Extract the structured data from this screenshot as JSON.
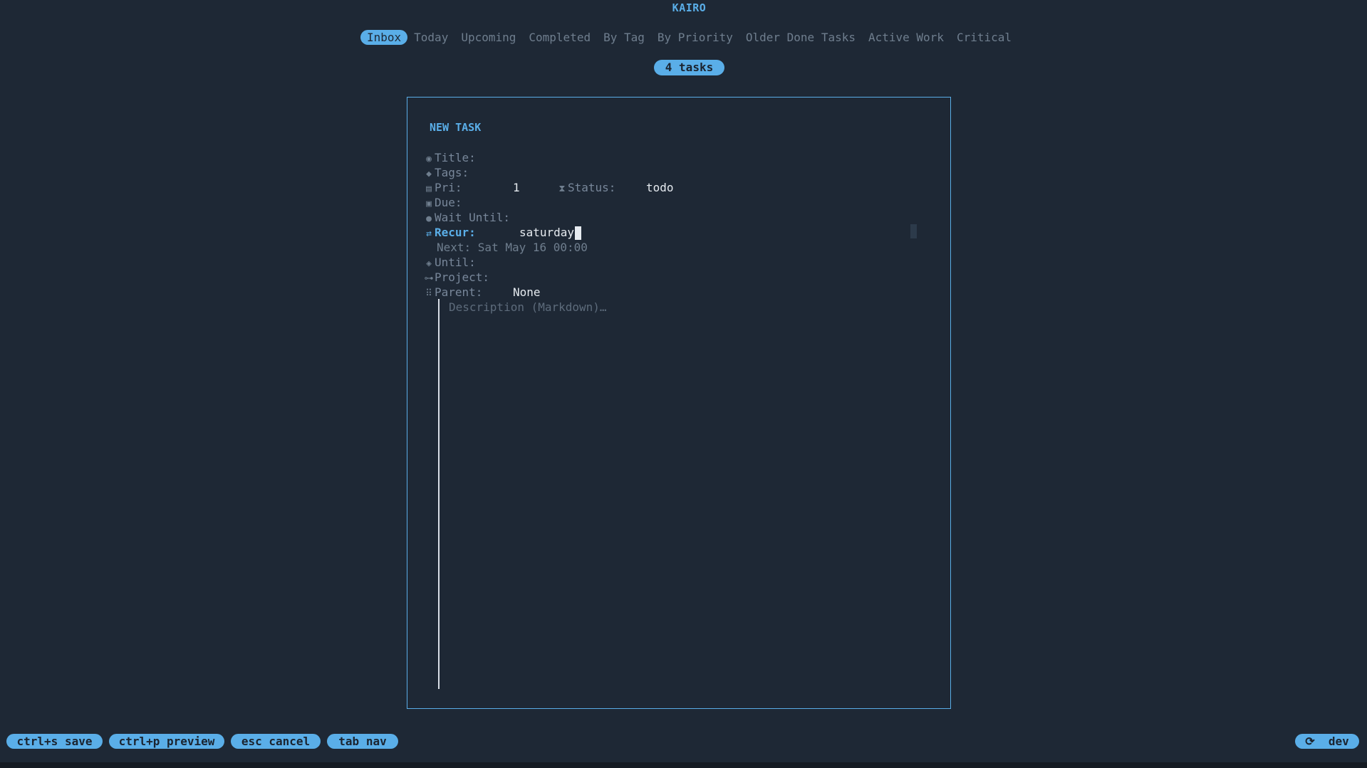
{
  "app": {
    "title": "KAIRO"
  },
  "tabs": [
    "Inbox",
    "Today",
    "Upcoming",
    "Completed",
    "By Tag",
    "By Priority",
    "Older Done Tasks",
    "Active Work",
    "Critical"
  ],
  "active_tab": "Inbox",
  "task_count": "4 tasks",
  "form": {
    "title": "NEW TASK",
    "fields": {
      "title": {
        "label": "Title:",
        "value": "",
        "icon": "eye-icon"
      },
      "tags": {
        "label": "Tags:",
        "value": "",
        "icon": "tag-icon"
      },
      "pri": {
        "label": "Pri:",
        "value": "1",
        "icon": "priority-icon"
      },
      "status": {
        "label": "Status:",
        "value": "todo",
        "icon": "hourglass-icon"
      },
      "due": {
        "label": "Due:",
        "value": "",
        "icon": "calendar-icon"
      },
      "wait_until": {
        "label": "Wait Until:",
        "value": "",
        "icon": "clock-icon"
      },
      "recur": {
        "label": "Recur:",
        "value": "saturday",
        "icon": "repeat-icon"
      },
      "until": {
        "label": "Until:",
        "value": "",
        "icon": "shield-icon"
      },
      "project": {
        "label": "Project:",
        "value": "",
        "icon": "project-icon"
      },
      "parent": {
        "label": "Parent:",
        "value": "None",
        "icon": "grid-icon"
      }
    },
    "next_occurrence": "Next: Sat May 16 00:00",
    "description_placeholder": "Description (Markdown)…"
  },
  "footer": {
    "keys": [
      "ctrl+s save",
      "ctrl+p preview",
      "esc cancel",
      "tab nav"
    ],
    "env": "dev"
  },
  "colors": {
    "accent": "#5aaee8",
    "background": "#1e2835",
    "text": "#e6ebf0"
  }
}
